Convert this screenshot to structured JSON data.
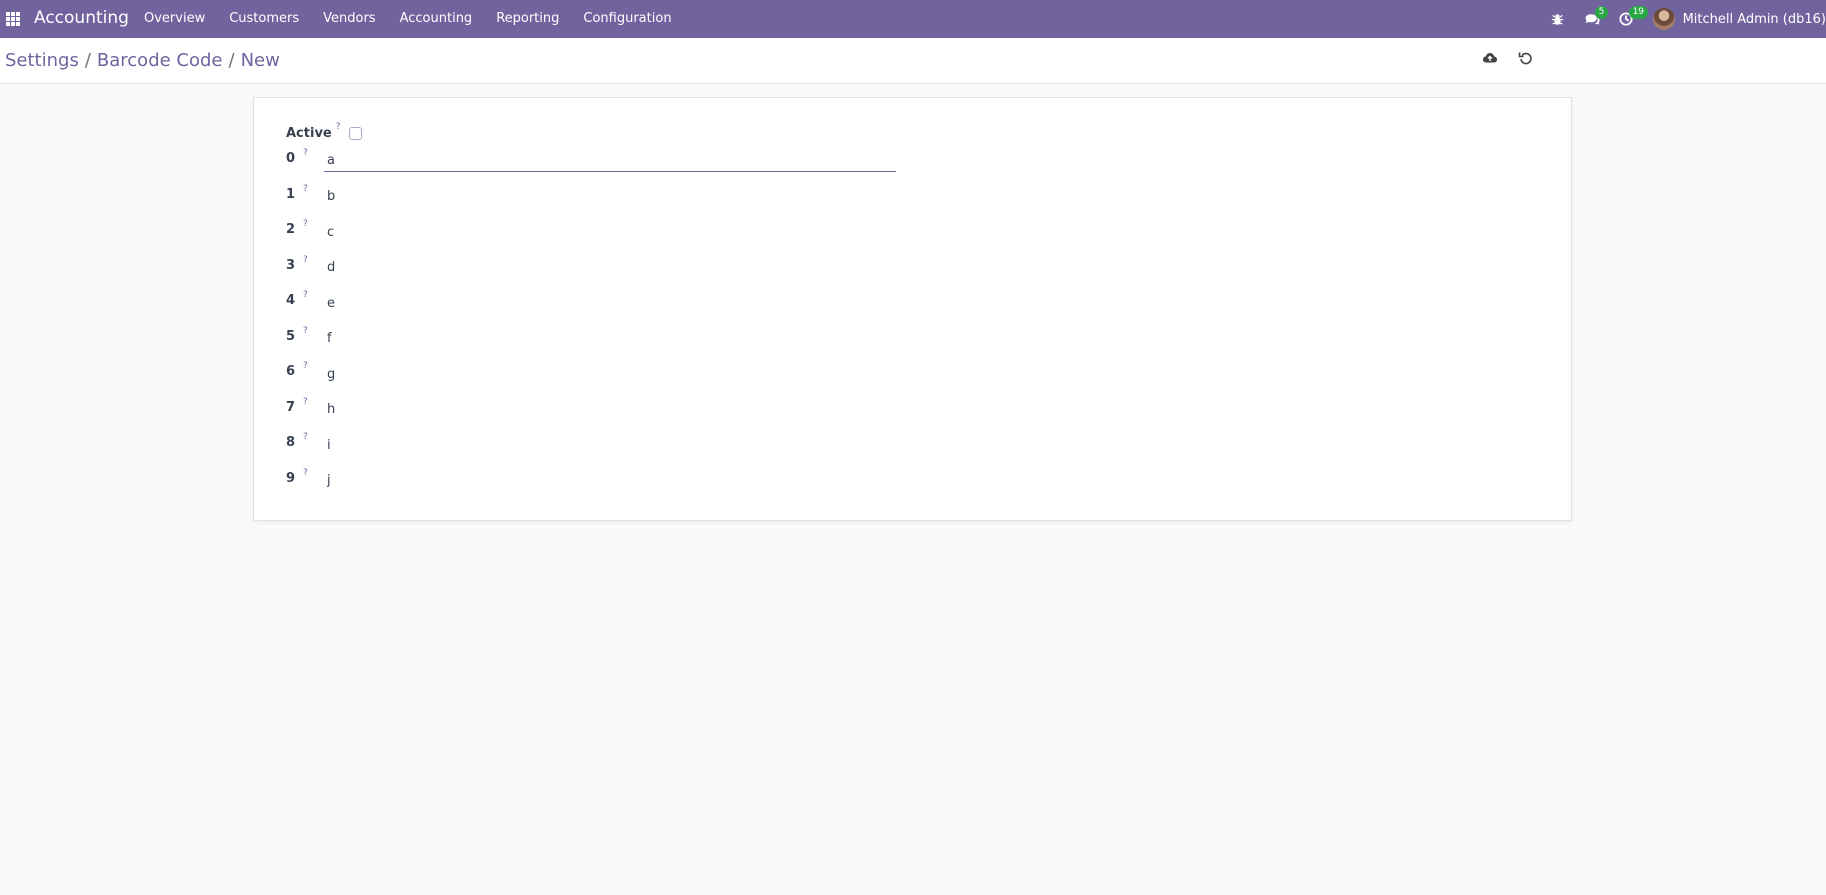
{
  "navbar": {
    "app_title": "Accounting",
    "menu": [
      "Overview",
      "Customers",
      "Vendors",
      "Accounting",
      "Reporting",
      "Configuration"
    ],
    "messages_count": "5",
    "activities_count": "19",
    "user_name": "Mitchell Admin (db16)",
    "color": "#71639e"
  },
  "breadcrumb": {
    "items": [
      "Settings",
      "Barcode Code"
    ],
    "current": "New",
    "separator": "/"
  },
  "form": {
    "active_label": "Active",
    "active_checked": false,
    "help_marker": "?",
    "digits": [
      {
        "label": "0",
        "value": "a"
      },
      {
        "label": "1",
        "value": "b"
      },
      {
        "label": "2",
        "value": "c"
      },
      {
        "label": "3",
        "value": "d"
      },
      {
        "label": "4",
        "value": "e"
      },
      {
        "label": "5",
        "value": "f"
      },
      {
        "label": "6",
        "value": "g"
      },
      {
        "label": "7",
        "value": "h"
      },
      {
        "label": "8",
        "value": "i"
      },
      {
        "label": "9",
        "value": "j"
      }
    ]
  },
  "icons": {
    "apps": "apps-grid-icon",
    "debug": "bug-icon",
    "messages": "chat-icon",
    "activities": "clock-icon",
    "save": "cloud-upload-icon",
    "discard": "undo-icon"
  }
}
